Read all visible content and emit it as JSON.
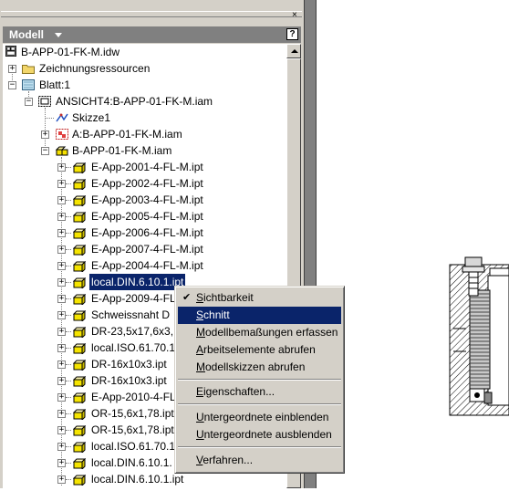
{
  "panel": {
    "header_title": "Modell",
    "help_label": "?",
    "close_label": "×"
  },
  "tree": {
    "root": "B-APP-01-FK-M.idw",
    "drawing_resources": "Zeichnungsressourcen",
    "sheet": "Blatt:1",
    "view": "ANSICHT4:B-APP-01-FK-M.iam",
    "sketch": "Skizze1",
    "ref_assembly": "A:B-APP-01-FK-M.iam",
    "assembly": "B-APP-01-FK-M.iam",
    "parts": [
      "E-App-2001-4-FL-M.ipt",
      "E-App-2002-4-FL-M.ipt",
      "E-App-2003-4-FL-M.ipt",
      "E-App-2005-4-FL-M.ipt",
      "E-App-2006-4-FL-M.ipt",
      "E-App-2007-4-FL-M.ipt",
      "E-App-2004-4-FL-M.ipt",
      "local.DIN.6.10.1.ipt",
      "E-App-2009-4-FL",
      "Schweissnaht D",
      "DR-23,5x17,6x3,",
      "local.ISO.61.70.1",
      "DR-16x10x3.ipt",
      "DR-16x10x3.ipt",
      "E-App-2010-4-FL",
      "OR-15,6x1,78.ipt",
      "OR-15,6x1,78.ipt",
      "local.ISO.61.70.1",
      "local.DIN.6.10.1.",
      "local.DIN.6.10.1.ipt"
    ],
    "selected_index": 7
  },
  "menu": {
    "items": [
      {
        "label": "Sichtbarkeit",
        "checked": true
      },
      {
        "label": "Schnitt",
        "highlighted": true
      },
      {
        "label": "Modellbemaßungen erfassen"
      },
      {
        "label": "Arbeitselemente abrufen"
      },
      {
        "label": "Modellskizzen abrufen"
      },
      {
        "label": "Eigenschaften..."
      },
      {
        "label": "Untergeordnete einblenden"
      },
      {
        "label": "Untergeordnete ausblenden"
      },
      {
        "label": "Verfahren..."
      }
    ]
  }
}
